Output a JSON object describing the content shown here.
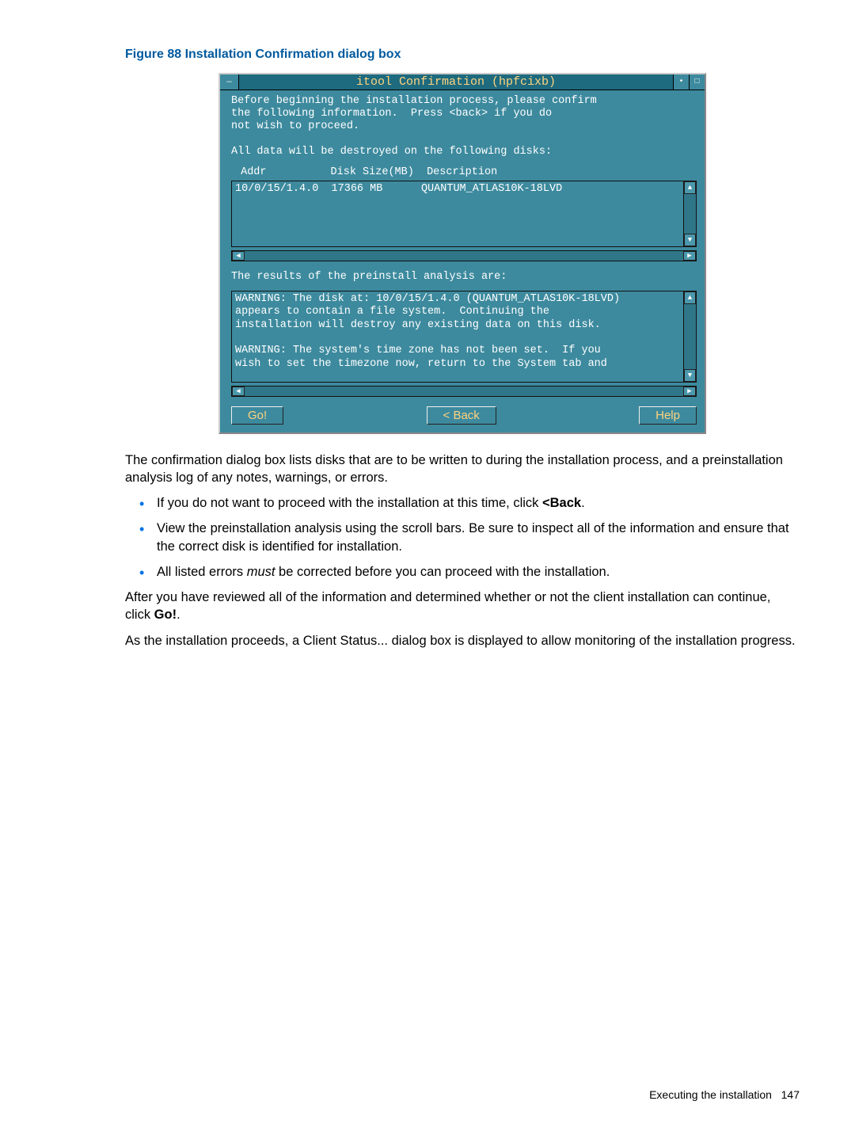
{
  "caption": "Figure 88 Installation Confirmation dialog box",
  "dialog": {
    "title": "itool Confirmation (hpfcixb)",
    "intro_line1": "Before beginning the installation process, please confirm",
    "intro_line2": "the following information.  Press <back> if you do",
    "intro_line3": "not wish to proceed.",
    "destroy_line": "All data will be destroyed on the following disks:",
    "col_addr": "Addr",
    "col_size": "Disk Size(MB)",
    "col_desc": "Description",
    "disk_row": "10/0/15/1.4.0  17366 MB      QUANTUM_ATLAS10K-18LVD",
    "analysis_label": "The results of the preinstall analysis are:",
    "warn1_l1": "WARNING: The disk at: 10/0/15/1.4.0 (QUANTUM_ATLAS10K-18LVD)",
    "warn1_l2": "appears to contain a file system.  Continuing the",
    "warn1_l3": "installation will destroy any existing data on this disk.",
    "warn2_l1": "WARNING: The system's time zone has not been set.  If you",
    "warn2_l2": "wish to set the timezone now, return to the System tab and",
    "buttons": {
      "go": "Go!",
      "back": "< Back",
      "help": "Help"
    }
  },
  "doc": {
    "p1": "The confirmation dialog box lists disks that are to be written to during the installation process, and a preinstallation analysis log of any notes, warnings, or errors.",
    "li1_a": "If you do not want to proceed with the installation at this time, click ",
    "li1_b": "<Back",
    "li1_c": ".",
    "li2": "View the preinstallation analysis using the scroll bars. Be sure to inspect all of the information and ensure that the correct disk is identified for installation.",
    "li3_a": "All listed errors ",
    "li3_b": "must",
    "li3_c": " be corrected before you can proceed with the installation.",
    "p2_a": "After you have reviewed all of the information and determined whether or not the client installation can continue, click ",
    "p2_b": "Go!",
    "p2_c": ".",
    "p3": "As the installation proceeds, a Client Status... dialog box is displayed to allow monitoring of the installation progress."
  },
  "footer": {
    "section": "Executing the installation",
    "page": "147"
  }
}
